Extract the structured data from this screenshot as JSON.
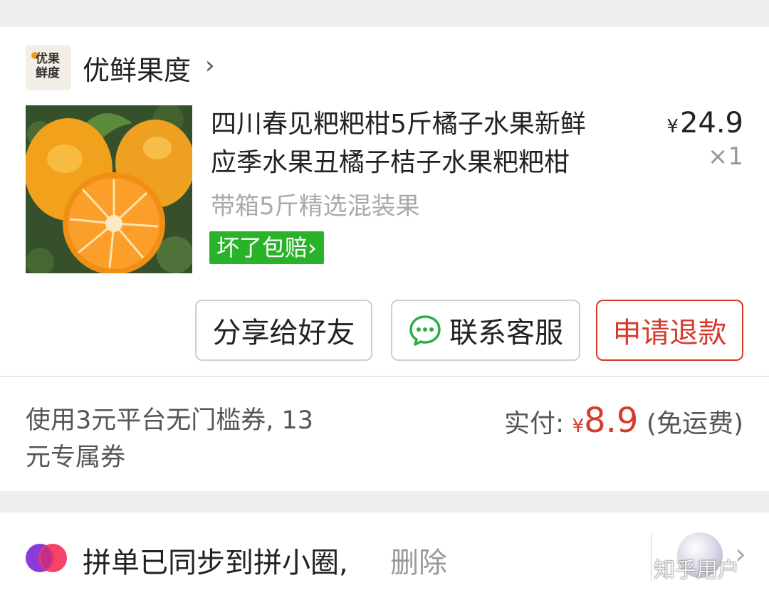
{
  "store": {
    "logo_text": "优果鲜度",
    "name": "优鲜果度",
    "chevron": "›"
  },
  "product": {
    "title_line1": "四川春见粑粑柑5斤橘子水果新鲜",
    "title_line2": "应季水果丑橘子桔子水果粑粑柑",
    "currency": "¥",
    "price": "24.9",
    "quantity": "×1",
    "spec": "带箱5斤精选混装果",
    "guarantee": "坏了包赔",
    "guarantee_chevron": "›"
  },
  "actions": {
    "share": "分享给好友",
    "contact": "联系客服",
    "refund": "申请退款"
  },
  "summary": {
    "coupon_line1": "使用3元平台无门槛券, 13",
    "coupon_line2": "元专属券",
    "paid_label": "实付: ",
    "paid_currency": "¥",
    "paid_amount": "8.9",
    "shipping_note": " (免运费)"
  },
  "pin": {
    "text": "拼单已同步到拼小圈,",
    "delete": "删除",
    "chevron": "›"
  },
  "watermark": "知乎用户",
  "colors": {
    "accent_red": "#d43b2b",
    "guarantee_green": "#29b329",
    "wechat_green": "#2aae46"
  },
  "icons": {
    "contact": "chat-bubble-icon",
    "pin": "pin-circle-icon",
    "avatar": "avatar-image"
  }
}
